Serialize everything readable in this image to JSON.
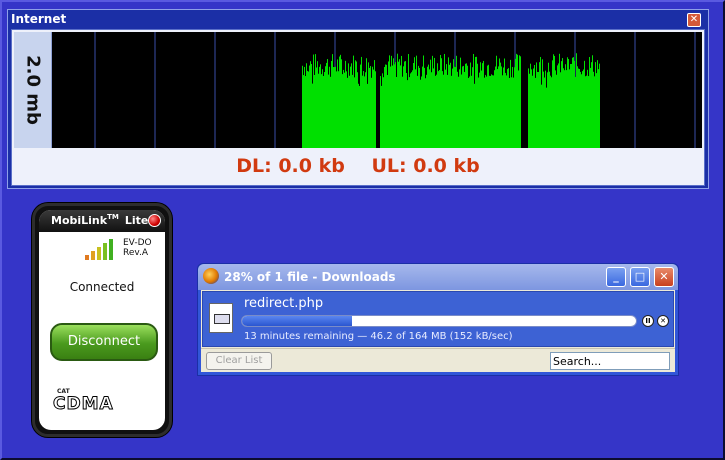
{
  "internet_window": {
    "title": "Internet",
    "close_glyph": "✕",
    "scale_label": "2.0 mb",
    "download_speed": "DL: 0.0 kb",
    "upload_speed": "UL: 0.0 kb",
    "colors": {
      "graph_bg": "#000000",
      "traffic": "#00e000",
      "grid": "#3a4ea8",
      "speed_text": "#d13a10"
    }
  },
  "mobilink": {
    "brand": "MobiLink",
    "trademark": "TM",
    "edition": "Lite",
    "network_line1": "EV-DO",
    "network_line2": "Rev.A",
    "status": "Connected",
    "disconnect_label": "Disconnect",
    "logo_small": "CAT",
    "logo_main": "CDMA",
    "close_icon": "close-dot-icon"
  },
  "downloads_window": {
    "title": "28% of 1 file - Downloads",
    "minimize_glyph": "_",
    "maximize_glyph": "□",
    "close_glyph": "✕",
    "item": {
      "filename": "redirect.php",
      "progress_percent": 28,
      "status": "13 minutes remaining — 46.2 of 164 MB (152 kB/sec)",
      "pause_glyph": "II",
      "cancel_glyph": "✕"
    },
    "clear_list_label": "Clear List",
    "search_placeholder": "Search..."
  }
}
